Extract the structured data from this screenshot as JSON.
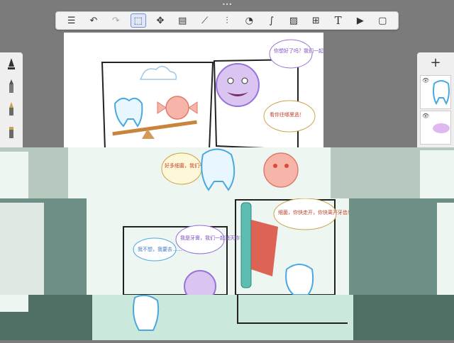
{
  "toolbar": {
    "tools": [
      {
        "name": "list-icon",
        "label": "☰"
      },
      {
        "name": "undo-icon",
        "label": "↶"
      },
      {
        "name": "redo-icon",
        "label": "↷"
      },
      {
        "name": "selection-icon",
        "label": "⬚"
      },
      {
        "name": "move-icon",
        "label": "✥"
      },
      {
        "name": "layer-icon",
        "label": "▤"
      },
      {
        "name": "ruler-icon",
        "label": "⟋"
      },
      {
        "name": "symmetry-icon",
        "label": "⫶"
      },
      {
        "name": "shape-icon",
        "label": "◔"
      },
      {
        "name": "curve-icon",
        "label": "∫"
      },
      {
        "name": "image-icon",
        "label": "▨"
      },
      {
        "name": "grid-icon",
        "label": "⊞"
      },
      {
        "name": "text-icon",
        "label": "T"
      },
      {
        "name": "video-icon",
        "label": "▶"
      },
      {
        "name": "fullscreen-icon",
        "label": "▢"
      }
    ],
    "active_tool": "selection-icon"
  },
  "right_panel": {
    "add_label": "+"
  },
  "comic": {
    "bubble_top_right": "你想好了吗？我们一起来消灭你！",
    "bubble_mid": "看你往哪里逃！",
    "bubble_right": "细菌，你快走开，你快离开牙齿！",
    "bubble_left": "好多细菌，我们一起刷牙吧",
    "bubble_bottom_left": "我不想，我要去……",
    "bubble_bottom_mid": "我是牙膏，我们一起消灭你！"
  },
  "colors": {
    "purple": "#b48ee0",
    "pink": "#f2a6a0",
    "teal": "#5ebcb0",
    "red": "#d94a3a",
    "blue": "#4aa8e0"
  }
}
